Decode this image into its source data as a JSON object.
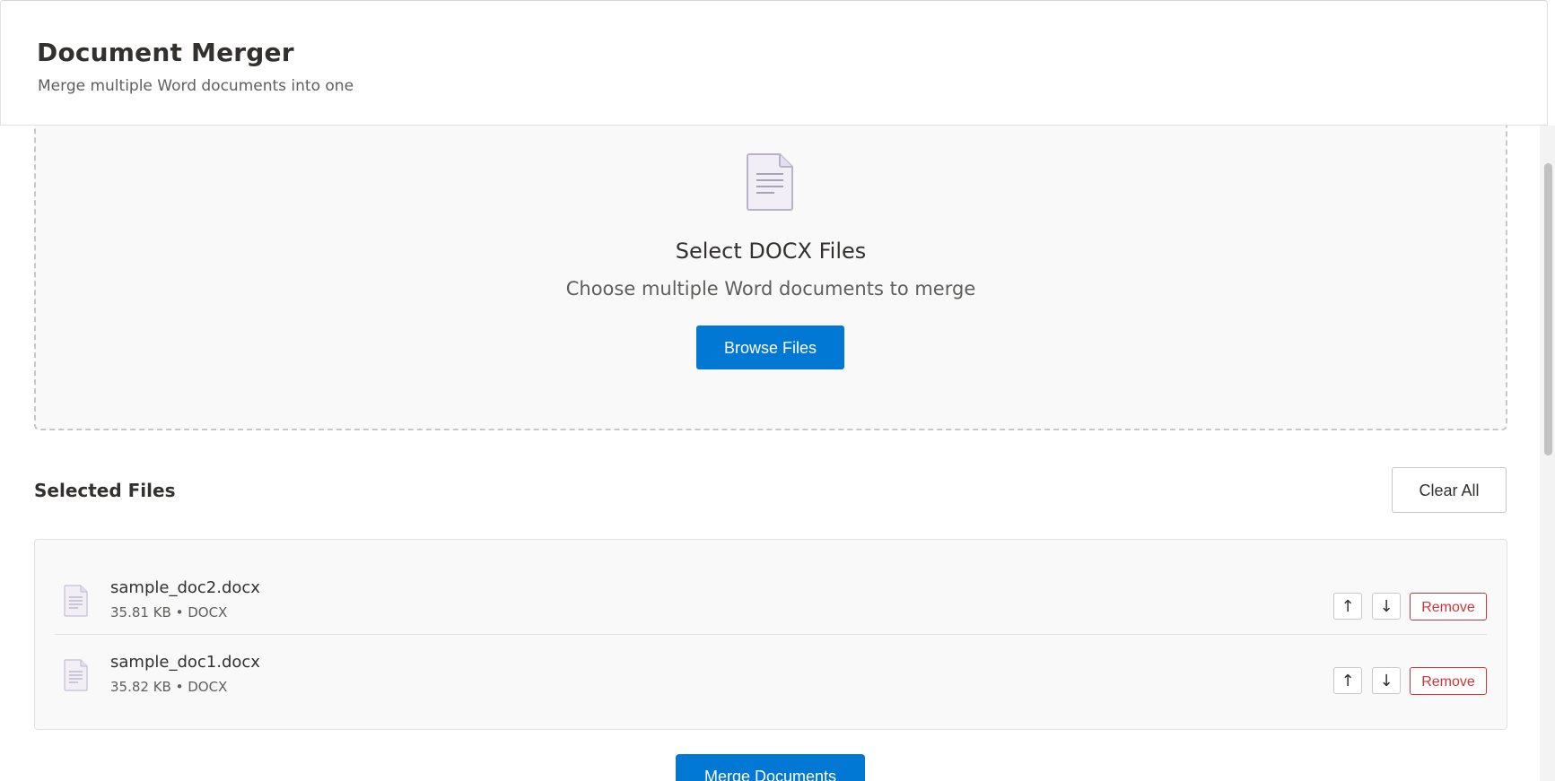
{
  "header": {
    "title": "Document Merger",
    "subtitle": "Merge multiple Word documents into one"
  },
  "dropzone": {
    "icon": "document-icon",
    "title": "Select DOCX Files",
    "subtitle": "Choose multiple Word documents to merge",
    "browse_label": "Browse Files"
  },
  "selected": {
    "heading": "Selected Files",
    "clear_label": "Clear All",
    "files": [
      {
        "name": "sample_doc2.docx",
        "meta": "35.81 KB • DOCX",
        "up_label": "↑",
        "down_label": "↓",
        "remove_label": "Remove"
      },
      {
        "name": "sample_doc1.docx",
        "meta": "35.82 KB • DOCX",
        "up_label": "↑",
        "down_label": "↓",
        "remove_label": "Remove"
      }
    ]
  },
  "actions": {
    "merge_label": "Merge Documents"
  },
  "colors": {
    "accent": "#0078d4",
    "danger": "#d13438",
    "text": "#323130",
    "muted_text": "#605e5c",
    "icon_fill": "#f1eef6",
    "icon_stroke": "#b9b3c6"
  }
}
